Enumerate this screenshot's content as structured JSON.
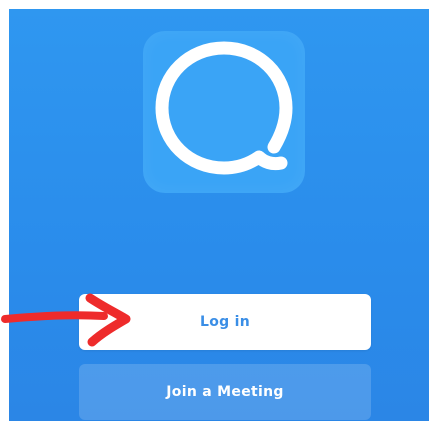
{
  "app": {
    "logo_icon": "chat-bubble-icon",
    "brand_color": "#2d8cff"
  },
  "annotation": {
    "arrow_icon": "red-arrow-icon",
    "arrow_color": "#ee2b2b"
  },
  "actions": {
    "login_label": "Log in",
    "join_label": "Join a Meeting"
  }
}
